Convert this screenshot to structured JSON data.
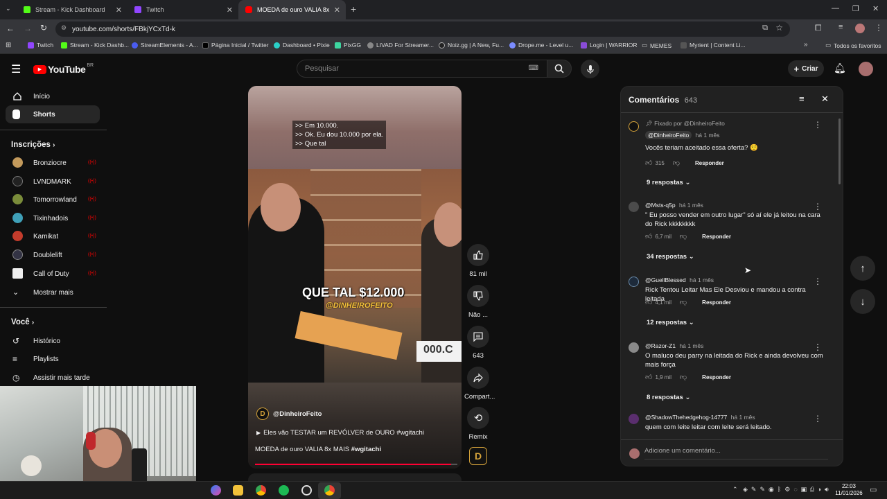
{
  "browser": {
    "tabs": [
      {
        "label": "Stream - Kick Dashboard",
        "color": "#53fc18"
      },
      {
        "label": "Twitch",
        "color": "#9146ff"
      },
      {
        "label": "MOEDA de ouro VALIA 8x",
        "color": "#ff0000"
      }
    ],
    "url": "youtube.com/shorts/FBkjYCxTd-k",
    "bookmarks": [
      "Twitch",
      "Stream - Kick Dashb...",
      "StreamElements - A...",
      "Página Inicial / Twitter",
      "Dashboard • Pixie",
      "PixGG",
      "LIVAD For Streamer...",
      "Noiz.gg | A New, Fu...",
      "Drope.me - Level u...",
      "Login | WARRIOR",
      "MEMES",
      "Myrient | Content Li..."
    ],
    "all_favorites": "Todos os favoritos"
  },
  "youtube": {
    "logo_text": "YouTube",
    "region": "BR",
    "search_placeholder": "Pesquisar",
    "create_label": "Criar"
  },
  "sidebar": {
    "home": "Início",
    "shorts": "Shorts",
    "subs_heading": "Inscrições",
    "subscriptions": [
      "Bronziocre",
      "LVNDMARK",
      "Tomorrowland",
      "Tixinhadois",
      "Kamikat",
      "Doublelift",
      "Call of Duty"
    ],
    "show_more": "Mostrar mais",
    "you_heading": "Você",
    "history": "Histórico",
    "playlists": "Playlists",
    "watch_later": "Assistir mais tarde"
  },
  "video": {
    "caption_lines": [
      ">> Em 10.000.",
      ">> Ok. Eu dou 10.000 por ela.",
      ">> Que tal"
    ],
    "overlay_text": "QUE TAL $12.000",
    "watermark": "@DINHEIROFEITO",
    "side_sign": "000.C",
    "channel": "@DinheiroFeito",
    "related_link": "Eles vão TESTAR um REVÓLVER de OURO #wgitachi",
    "title": "MOEDA de ouro VALIA 8x MAIS",
    "title_tag": "#wgitachi",
    "progress": 0.97
  },
  "actions": {
    "likes": "81 mil",
    "dislike": "Não ...",
    "comments": "643",
    "share": "Compart...",
    "remix": "Remix"
  },
  "comments_panel": {
    "title": "Comentários",
    "count": "643",
    "add_placeholder": "Adicione um comentário...",
    "reply_label": "Responder",
    "items": [
      {
        "pinned": "Fixado por @DinheiroFeito",
        "author": "@DinheiroFeito",
        "time": "há 1 mês",
        "text": "Vocês teriam aceitado essa oferta? 🤨",
        "likes": "315",
        "replies": "9 respostas"
      },
      {
        "author": "@Msts-q5p",
        "time": "há 1 mês",
        "text": "\" Eu posso vender em outro lugar\" só aí ele já leitou na cara do Rick kkkkkkkk",
        "likes": "6,7 mil",
        "replies": "34 respostas"
      },
      {
        "author": "@GuellBlessed",
        "time": "há 1 mês",
        "text": "Rick Tentou Leitar Mas Ele Desviou e mandou a contra leitada",
        "likes": "4,1 mil",
        "replies": "12 respostas"
      },
      {
        "author": "@Razor-Z1",
        "time": "há 1 mês",
        "text": "O maluco deu parry na leitada do Rick e ainda devolveu com mais força",
        "likes": "1,9 mil",
        "replies": "8 respostas"
      },
      {
        "author": "@ShadowThehedgehog-14777",
        "time": "há 1 mês",
        "text": "quem com leite leitar com leite será leitado."
      }
    ]
  },
  "taskbar": {
    "time": "22:03",
    "date": "11/01/2026"
  }
}
